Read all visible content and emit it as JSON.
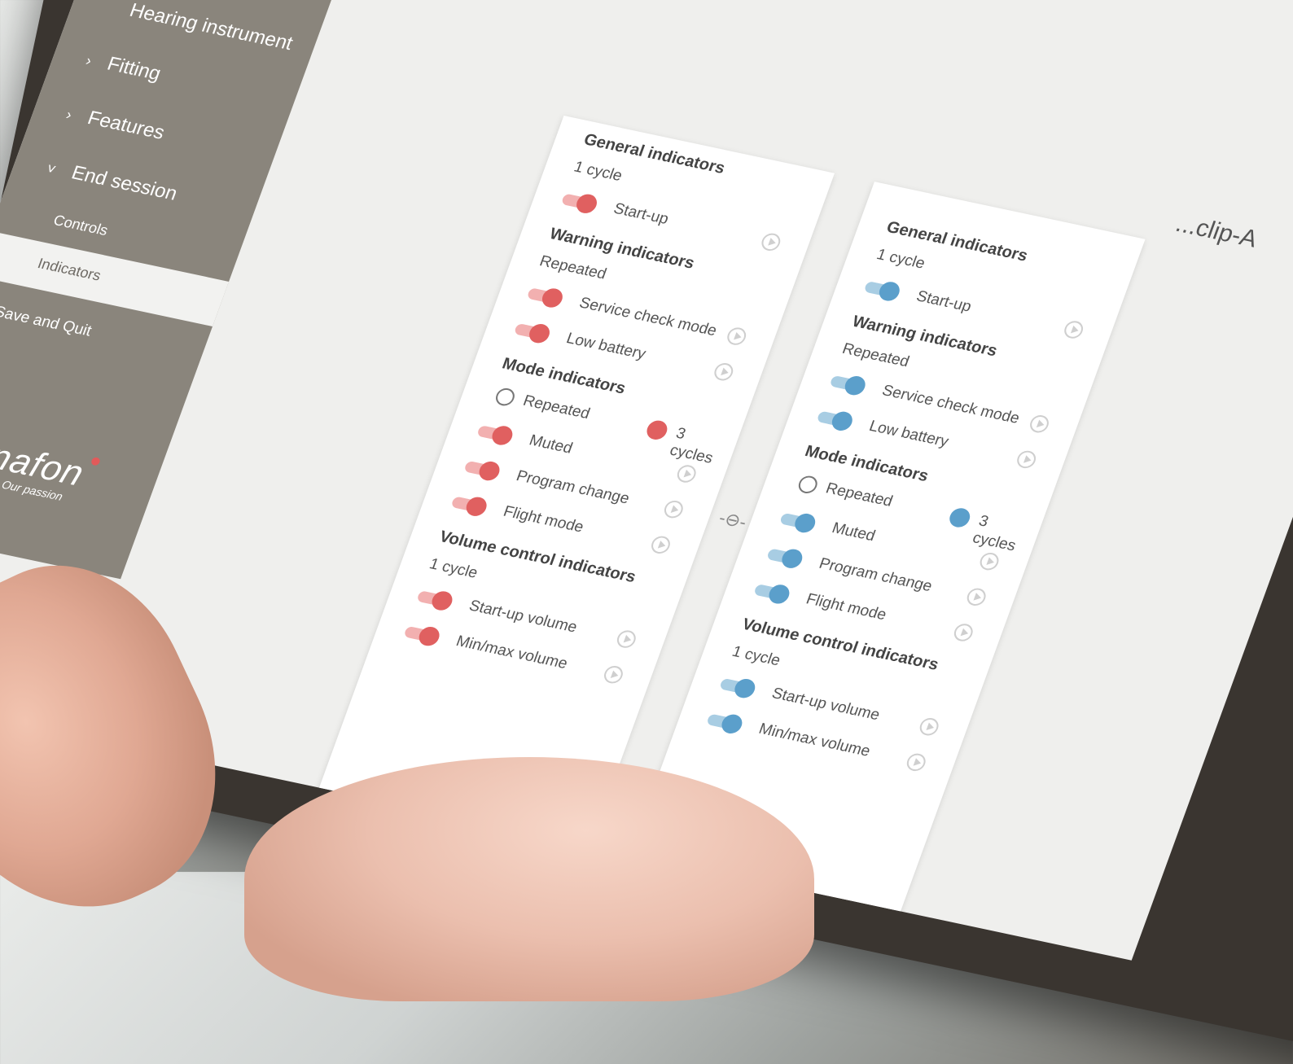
{
  "sidebar": {
    "items": [
      {
        "label": "Hearing instrument",
        "chevron": ""
      },
      {
        "label": "Fitting",
        "chevron": "›"
      },
      {
        "label": "Features",
        "chevron": "›"
      },
      {
        "label": "End session",
        "chevron": "˅"
      }
    ],
    "sub_items": [
      "Controls",
      "Indicators"
    ],
    "active_sub": "Indicators",
    "save_quit": "Save and Quit"
  },
  "logo": {
    "name": "bernafon",
    "tagline": "Your hearing · Our passion"
  },
  "window_title": "...clip-A",
  "colors": {
    "left_accent": "#e06060",
    "right_accent": "#5b9fcb",
    "sidebar": "#8a857c"
  },
  "panels": {
    "left": {
      "general_header": "General indicators",
      "general_sub": "1 cycle",
      "startup": "Start-up",
      "warning_header": "Warning indicators",
      "warning_sub": "Repeated",
      "service_check": "Service check mode",
      "low_battery": "Low battery",
      "mode_header": "Mode indicators",
      "mode_repeated": "Repeated",
      "mode_cycles": "3 cycles",
      "muted": "Muted",
      "program_change": "Program change",
      "flight_mode": "Flight mode",
      "volume_header": "Volume control indicators",
      "volume_sub": "1 cycle",
      "startup_volume": "Start-up volume",
      "minmax_volume": "Min/max volume"
    },
    "right": {
      "general_header": "General indicators",
      "general_sub": "1 cycle",
      "startup": "Start-up",
      "warning_header": "Warning indicators",
      "warning_sub": "Repeated",
      "service_check": "Service check mode",
      "low_battery": "Low battery",
      "mode_header": "Mode indicators",
      "mode_repeated": "Repeated",
      "mode_cycles": "3 cycles",
      "muted": "Muted",
      "program_change": "Program change",
      "flight_mode": "Flight mode",
      "volume_header": "Volume control indicators",
      "volume_sub": "1 cycle",
      "startup_volume": "Start-up volume",
      "minmax_volume": "Min/max volume"
    }
  },
  "link_icon": "link-icon"
}
